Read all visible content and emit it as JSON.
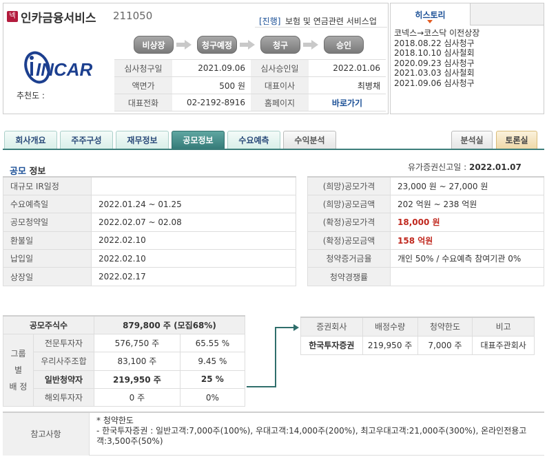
{
  "header": {
    "market_badge": "넥",
    "company_name": "인카금융서비스",
    "company_code": "211050",
    "status_tag": "[진행]",
    "industry": "보험 및 연금관련 서비스업",
    "logo_text": "INCAR",
    "recommend_label": "추천도 :",
    "steps": [
      "비상장",
      "청구예정",
      "청구",
      "승인"
    ],
    "info": [
      {
        "label1": "심사청구일",
        "value1": "2021.09.06",
        "label2": "심사승인일",
        "value2": "2022.01.06"
      },
      {
        "label1": "액면가",
        "value1": "500 원",
        "label2": "대표이사",
        "value2": "최병채"
      },
      {
        "label1": "대표전화",
        "value1": "02-2192-8916",
        "label2": "홈페이지",
        "value2": "바로가기"
      }
    ]
  },
  "history": {
    "tab_label": "히스토리",
    "items": [
      "코넥스→코스닥 이전상장",
      "2018.08.22 심사청구",
      "2018.10.10 심사철회",
      "2020.09.23 심사청구",
      "2021.03.03 심사철회",
      "2021.09.06 심사청구"
    ]
  },
  "tabs": {
    "left": [
      "회사개요",
      "주주구성",
      "재무정보",
      "공모정보",
      "수요예측",
      "수익분석"
    ],
    "right": [
      "분석실",
      "토론실"
    ],
    "active": "공모정보"
  },
  "ipo": {
    "title_accent": "공모",
    "title_rest": "정보",
    "filing_label": "유가증권신고일 :",
    "filing_date": "2022.01.07",
    "schedule": [
      {
        "label": "대규모 IR일정",
        "value": ""
      },
      {
        "label": "수요예측일",
        "value": "2022.01.24 ~ 01.25"
      },
      {
        "label": "공모청약일",
        "value": "2022.02.07 ~ 02.08"
      },
      {
        "label": "환불일",
        "value": "2022.02.10"
      },
      {
        "label": "납입일",
        "value": "2022.02.10"
      },
      {
        "label": "상장일",
        "value": "2022.02.17"
      }
    ],
    "price": [
      {
        "label": "(희망)공모가격",
        "value": "23,000 원 ~ 27,000 원"
      },
      {
        "label": "(희망)공모금액",
        "value": "202 억원 ~ 238 억원"
      },
      {
        "label": "(확정)공모가격",
        "value": "18,000 원"
      },
      {
        "label": "(확정)공모금액",
        "value": "158 억원"
      },
      {
        "label": "청약증거금율",
        "value": "개인 50% / 수요예측 참여기관 0%"
      },
      {
        "label": "청약경쟁률",
        "value": ""
      }
    ]
  },
  "allocation": {
    "total_label": "공모주식수",
    "total_value": "879,800 주 (모집68%)",
    "group_label_1": "그룹별",
    "group_label_2": "배 정",
    "rows": [
      {
        "label": "전문투자자",
        "shares": "576,750 주",
        "pct": "65.55 %"
      },
      {
        "label": "우리사주조합",
        "shares": "83,100 주",
        "pct": "9.45 %"
      },
      {
        "label": "일반청약자",
        "shares": "219,950 주",
        "pct": "25 %"
      },
      {
        "label": "해외투자자",
        "shares": "0 주",
        "pct": "0%"
      }
    ]
  },
  "underwriter": {
    "headers": [
      "증권회사",
      "배정수량",
      "청약한도",
      "비고"
    ],
    "rows": [
      {
        "company": "한국투자증권",
        "qty": "219,950 주",
        "limit": "7,000 주",
        "note": "대표주관회사"
      }
    ]
  },
  "notes": {
    "label": "참고사항",
    "line1": "* 청약한도",
    "line2": "- 한국투자증권 : 일반고객:7,000주(100%), 우대고객:14,000주(200%), 최고우대고객:21,000주(300%), 온라인전용고객:3,500주(50%)"
  }
}
